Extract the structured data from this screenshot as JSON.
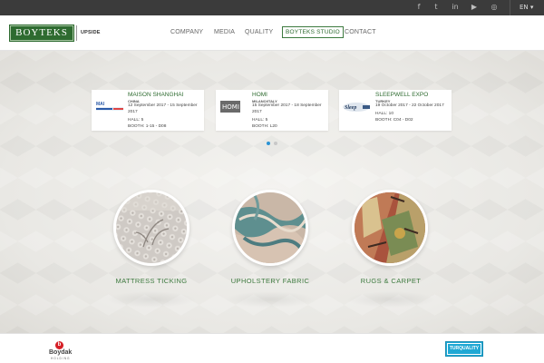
{
  "topbar": {
    "social_icons": [
      {
        "name": "facebook-icon",
        "glyph": "f"
      },
      {
        "name": "twitter-icon",
        "glyph": "t"
      },
      {
        "name": "linkedin-icon",
        "glyph": "in"
      },
      {
        "name": "youtube-icon",
        "glyph": "▶"
      },
      {
        "name": "instagram-icon",
        "glyph": "◎"
      }
    ],
    "language": "EN ▾"
  },
  "header": {
    "logo_text": "BOYTEKS",
    "logo_sub": "UPSIDE",
    "nav": [
      {
        "label": "COMPANY",
        "active": false
      },
      {
        "label": "MEDIA",
        "active": false
      },
      {
        "label": "QUALITY",
        "active": false
      },
      {
        "label": "BOYTEKS STUDIO",
        "active": true
      },
      {
        "label": "CONTACT",
        "active": false
      }
    ]
  },
  "events": [
    {
      "title": "MAISON SHANGHAI",
      "location": "CHINA",
      "dates": "12 September 2017 - 15 September 2017",
      "hall": "HALL: 5",
      "booth": "BOOTH: 1-15 - D08",
      "logo": "maison-logo"
    },
    {
      "title": "HOMI",
      "location": "MILANO/ITALY",
      "dates": "15 September 2017 - 18 September 2017",
      "hall": "HALL: 5",
      "booth": "BOOTH: L20",
      "logo": "homi-logo"
    },
    {
      "title": "SLEEPWELL EXPO",
      "location": "TURKEY",
      "dates": "19 October 2017 - 22 October 2017",
      "hall": "HALL: 10",
      "booth": "BOOTH: C04 - D02",
      "logo": "sleepwell-logo"
    }
  ],
  "carousel": {
    "pages": 2,
    "active": 0
  },
  "products": [
    {
      "label": "MATTRESS TICKING"
    },
    {
      "label": "UPHOLSTERY FABRIC"
    },
    {
      "label": "RUGS & CARPET"
    }
  ],
  "footer": {
    "holding_name": "Boydak",
    "holding_sub": "HOLDING",
    "badge": "TURQUALITY"
  },
  "colors": {
    "brand_green": "#2e6b30",
    "accent_green": "#3d7a3f",
    "turquality_blue": "#1fa8d4",
    "topbar": "#3b3b3b",
    "dot_active": "#2a93d5",
    "dot_inactive": "#c8c8c8"
  }
}
